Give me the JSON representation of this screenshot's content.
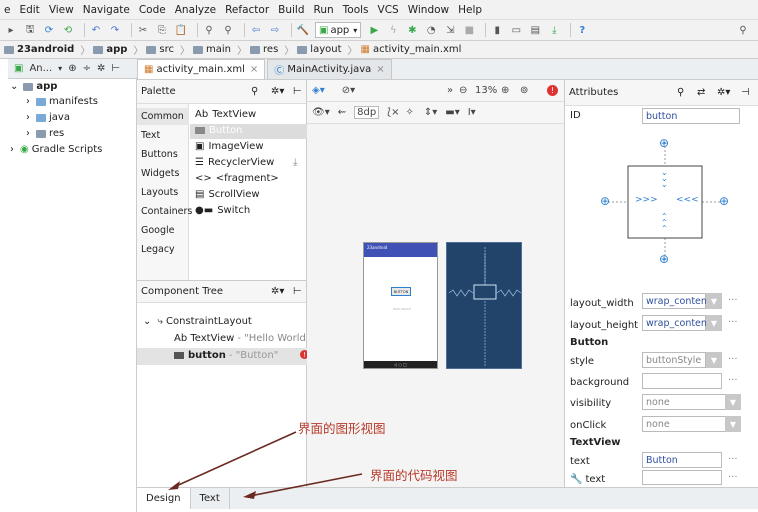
{
  "menu": [
    "e",
    "Edit",
    "View",
    "Navigate",
    "Code",
    "Analyze",
    "Refactor",
    "Build",
    "Run",
    "Tools",
    "VCS",
    "Window",
    "Help"
  ],
  "toolbar": {
    "run_config": "app"
  },
  "breadcrumb": [
    "23android",
    "app",
    "src",
    "main",
    "res",
    "layout",
    "activity_main.xml"
  ],
  "project_header": "An...",
  "project_tree": [
    {
      "label": "app",
      "bold": true
    },
    {
      "label": "manifests"
    },
    {
      "label": "java"
    },
    {
      "label": "res"
    },
    {
      "label": "Gradle Scripts"
    }
  ],
  "editor_tabs": [
    {
      "label": "activity_main.xml",
      "active": true
    },
    {
      "label": "MainActivity.java",
      "active": false
    }
  ],
  "palette": {
    "title": "Palette",
    "categories": [
      "Common",
      "Text",
      "Buttons",
      "Widgets",
      "Layouts",
      "Containers",
      "Google",
      "Legacy"
    ],
    "widgets": [
      "TextView",
      "Button",
      "ImageView",
      "RecyclerView",
      "<fragment>",
      "ScrollView",
      "Switch"
    ],
    "widget_icons": [
      "Ab",
      "",
      "img",
      "list",
      "<>",
      "scroll",
      "switch"
    ]
  },
  "component_tree": {
    "title": "Component Tree",
    "root": "ConstraintLayout",
    "textview_label": "Ab TextView",
    "textview_value": "- \"Hello World!\"",
    "button_id": "button",
    "button_value": "- \"Button\""
  },
  "design_toolbar": {
    "zoom": "13%",
    "margin": "8dp"
  },
  "phone_preview": {
    "title": "23android",
    "button_text": "BUTTON",
    "hello": "Hello World!"
  },
  "attributes": {
    "title": "Attributes",
    "id_label": "ID",
    "id_value": "button",
    "layout_width_label": "layout_width",
    "layout_width_value": "wrap_content",
    "layout_height_label": "layout_height",
    "layout_height_value": "wrap_content",
    "button_section": "Button",
    "style_label": "style",
    "style_value": "buttonStyle",
    "background_label": "background",
    "visibility_label": "visibility",
    "visibility_value": "none",
    "onclick_label": "onClick",
    "onclick_value": "none",
    "textview_section": "TextView",
    "text_label": "text",
    "text_value": "Button",
    "text2_label": "text"
  },
  "bottom_tabs": [
    "Design",
    "Text"
  ],
  "annotations": {
    "design_view": "界面的图形视图",
    "code_view": "界面的代码视图"
  },
  "colors": {
    "accent": "#2f7fd1",
    "run_green": "#3aa84a",
    "blueprint": "#23446a",
    "annot": "#b83a2a"
  }
}
